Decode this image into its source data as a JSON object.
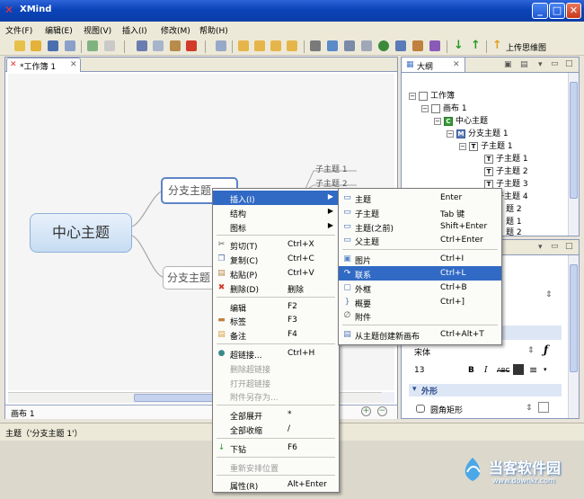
{
  "window": {
    "title": "XMind",
    "app_icon": "x-logo-icon"
  },
  "menubar": [
    "文件(F)",
    "编辑(E)",
    "视图(V)",
    "插入(I)",
    "修改(M)",
    "帮助(H)"
  ],
  "toolbar": {
    "upload_label": "上传思维图"
  },
  "editor": {
    "tab_label": "*工作簿 1",
    "sheet_tab": "画布 1"
  },
  "map": {
    "central": "中心主题",
    "branch1": "分支主题",
    "branch2": "分支主题",
    "sub1": "子主题 1",
    "sub2": "子主题 2"
  },
  "outline": {
    "tab_label": "大纲",
    "rows": [
      "工作簿",
      "画布 1",
      "中心主题",
      "分支主题 1",
      "子主题 1",
      "子主题 1",
      "子主题 2",
      "子主题 3",
      "子主题 4",
      "题 2",
      "题 1",
      "题 2"
    ]
  },
  "properties": {
    "font_name": "宋体",
    "font_size": "13",
    "section_outer": "外形",
    "shape_value": "圆角矩形",
    "font_icon": "italic-f-icon"
  },
  "status": {
    "text": "主题（'分支主题 1'）"
  },
  "context_menu": {
    "items": [
      {
        "label": "插入(I)",
        "shortcut": "",
        "icon": "",
        "submenu": true,
        "highlight": true
      },
      {
        "label": "结构",
        "shortcut": "",
        "icon": "",
        "submenu": true
      },
      {
        "label": "图标",
        "shortcut": "",
        "icon": "",
        "submenu": true
      },
      {
        "sep": true
      },
      {
        "label": "剪切(T)",
        "shortcut": "Ctrl+X",
        "icon": "scissors-icon"
      },
      {
        "label": "复制(C)",
        "shortcut": "Ctrl+C",
        "icon": "copy-icon"
      },
      {
        "label": "粘贴(P)",
        "shortcut": "Ctrl+V",
        "icon": "paste-icon"
      },
      {
        "label": "删除(D)",
        "shortcut": "删除",
        "icon": "delete-icon"
      },
      {
        "sep": true
      },
      {
        "label": "编辑",
        "shortcut": "F2",
        "icon": ""
      },
      {
        "label": "标签",
        "shortcut": "F3",
        "icon": "label-icon"
      },
      {
        "label": "备注",
        "shortcut": "F4",
        "icon": "note-icon"
      },
      {
        "sep": true
      },
      {
        "label": "超链接...",
        "shortcut": "Ctrl+H",
        "icon": "globe-icon"
      },
      {
        "label": "删除超链接",
        "shortcut": "",
        "icon": "",
        "disabled": true
      },
      {
        "label": "打开超链接",
        "shortcut": "",
        "icon": "",
        "disabled": true
      },
      {
        "label": "附件另存为...",
        "shortcut": "",
        "icon": "",
        "disabled": true
      },
      {
        "sep": true
      },
      {
        "label": "全部展开",
        "shortcut": "*",
        "icon": ""
      },
      {
        "label": "全部收缩",
        "shortcut": "/",
        "icon": ""
      },
      {
        "sep": true
      },
      {
        "label": "下钻",
        "shortcut": "F6",
        "icon": "drill-down-icon"
      },
      {
        "sep": true
      },
      {
        "label": "重新安排位置",
        "shortcut": "",
        "icon": "",
        "disabled": true
      },
      {
        "sep": true
      },
      {
        "label": "属性(R)",
        "shortcut": "Alt+Enter",
        "icon": ""
      }
    ]
  },
  "submenu": {
    "items": [
      {
        "label": "主题",
        "shortcut": "Enter",
        "icon": "topic-icon"
      },
      {
        "label": "子主题",
        "shortcut": "Tab 键",
        "icon": "subtopic-icon"
      },
      {
        "label": "主题(之前)",
        "shortcut": "Shift+Enter",
        "icon": "topic-before-icon"
      },
      {
        "label": "父主题",
        "shortcut": "Ctrl+Enter",
        "icon": "parent-topic-icon"
      },
      {
        "sep": true
      },
      {
        "label": "图片",
        "shortcut": "Ctrl+I",
        "icon": "image-icon"
      },
      {
        "label": "联系",
        "shortcut": "Ctrl+L",
        "icon": "relationship-icon",
        "highlight": true
      },
      {
        "label": "外框",
        "shortcut": "Ctrl+B",
        "icon": "boundary-icon"
      },
      {
        "label": "概要",
        "shortcut": "Ctrl+]",
        "icon": "summary-icon"
      },
      {
        "label": "附件",
        "shortcut": "",
        "icon": "attachment-icon"
      },
      {
        "sep": true
      },
      {
        "label": "从主题创建新画布",
        "shortcut": "Ctrl+Alt+T",
        "icon": "new-sheet-icon"
      }
    ]
  },
  "watermark": {
    "brand": "当客软件园",
    "url": "www.downkr.com"
  }
}
